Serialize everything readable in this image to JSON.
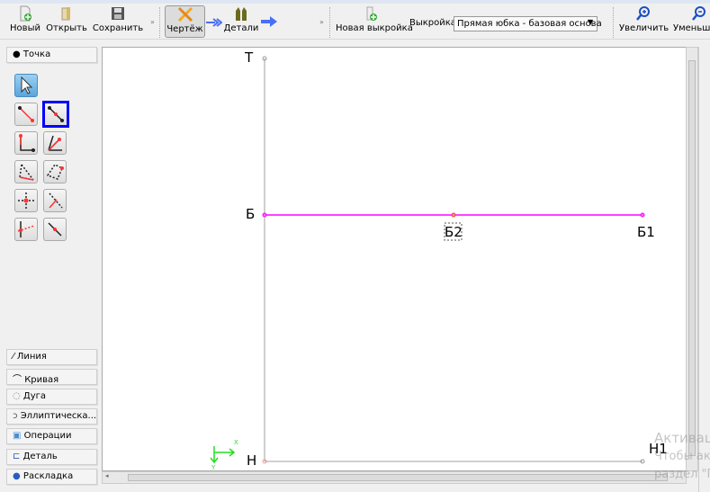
{
  "toolbar": {
    "new_label": "Новый",
    "open_label": "Открыть",
    "save_label": "Сохранить",
    "draw_label": "Чертёж",
    "details_label": "Детали",
    "new_pattern_label": "Новая выкройка",
    "pattern_label": "Выкройка:",
    "pattern_value": "Прямая юбка - базовая основа",
    "zoom_in_label": "Увеличить",
    "zoom_out_label": "Уменьши"
  },
  "panel": {
    "point_label": "Точка",
    "sections": [
      "Линия",
      "Кривая",
      "Дуга",
      "Эллиптическа...",
      "Операции",
      "Деталь",
      "Раскладка"
    ]
  },
  "drawing": {
    "points": [
      "Т",
      "Б",
      "Б2",
      "Б1",
      "Н",
      "Н1"
    ],
    "axis_x": "X",
    "axis_y": "Y",
    "colors": {
      "selected_line": "#ff00ff",
      "base_line": "#a0a0a0",
      "axis": "#22dd22",
      "selection": "#0000ff"
    }
  },
  "watermark": {
    "line1": "Активация Windows",
    "line2": "Чтобы активировать Windows, перейдите в",
    "line3": "раздел \"Параметры\""
  }
}
